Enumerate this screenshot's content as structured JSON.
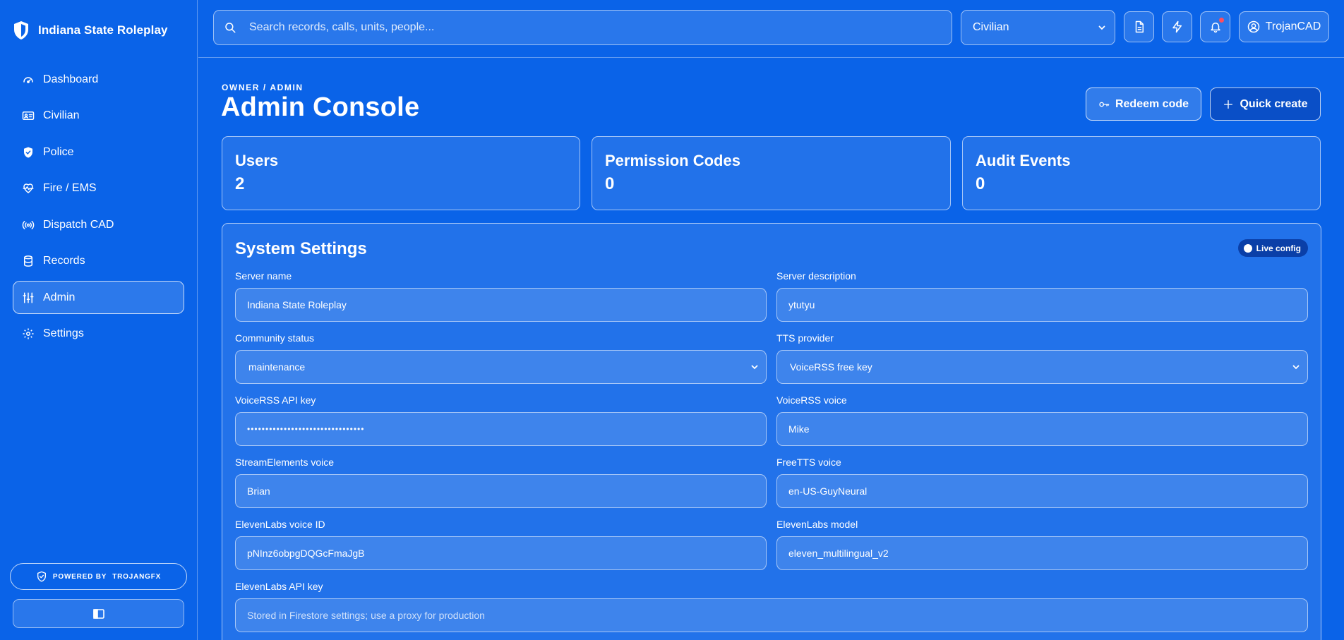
{
  "brand": {
    "name": "Indiana State Roleplay"
  },
  "sidebar": {
    "items": [
      {
        "label": "Dashboard"
      },
      {
        "label": "Civilian"
      },
      {
        "label": "Police"
      },
      {
        "label": "Fire / EMS"
      },
      {
        "label": "Dispatch CAD"
      },
      {
        "label": "Records"
      },
      {
        "label": "Admin",
        "active": true
      },
      {
        "label": "Settings"
      }
    ],
    "powered_label": "POWERED BY",
    "powered_brand": "TROJANGFX"
  },
  "topbar": {
    "search_placeholder": "Search records, calls, units, people...",
    "role_value": "Civilian",
    "user_name": "TrojanCAD"
  },
  "header": {
    "breadcrumb": "OWNER / ADMIN",
    "title": "Admin Console",
    "redeem_label": "Redeem code",
    "quick_create_label": "Quick create"
  },
  "stats": [
    {
      "label": "Users",
      "value": "2"
    },
    {
      "label": "Permission Codes",
      "value": "0"
    },
    {
      "label": "Audit Events",
      "value": "0"
    }
  ],
  "settings": {
    "title": "System Settings",
    "badge": "Live config",
    "fields": {
      "server_name": {
        "label": "Server name",
        "value": "Indiana State Roleplay"
      },
      "server_description": {
        "label": "Server description",
        "value": "ytutyu"
      },
      "community_status": {
        "label": "Community status",
        "value": "maintenance"
      },
      "tts_provider": {
        "label": "TTS provider",
        "value": "VoiceRSS free key"
      },
      "voicerss_key": {
        "label": "VoiceRSS API key",
        "value": "••••••••••••••••••••••••••••••••"
      },
      "voicerss_voice": {
        "label": "VoiceRSS voice",
        "value": "Mike"
      },
      "streamelements_voice": {
        "label": "StreamElements voice",
        "value": "Brian"
      },
      "freetts_voice": {
        "label": "FreeTTS voice",
        "value": "en-US-GuyNeural"
      },
      "elevenlabs_voice_id": {
        "label": "ElevenLabs voice ID",
        "value": "pNInz6obpgDQGcFmaJgB"
      },
      "elevenlabs_model": {
        "label": "ElevenLabs model",
        "value": "eleven_multilingual_v2"
      },
      "elevenlabs_key": {
        "label": "ElevenLabs API key",
        "placeholder": "Stored in Firestore settings; use a proxy for production"
      }
    }
  },
  "colors": {
    "background": "#0a63e8",
    "notification_dot": "#ff4d5e",
    "badge_bg": "#0a3fa8"
  }
}
